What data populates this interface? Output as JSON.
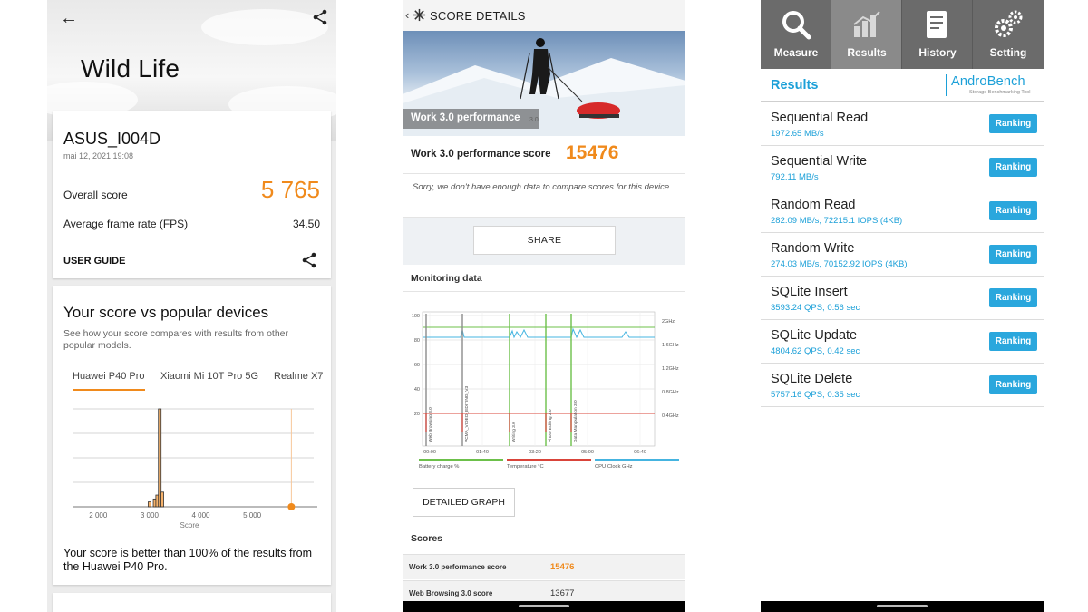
{
  "wildlife": {
    "title": "Wild Life",
    "device": "ASUS_I004D",
    "date": "mai 12, 2021 19:08",
    "overall_label": "Overall score",
    "overall_value": "5 765",
    "fps_label": "Average frame rate (FPS)",
    "fps_value": "34.50",
    "user_guide": "USER GUIDE",
    "compare_title": "Your score vs popular devices",
    "compare_sub": "See how your score compares with results from other popular models.",
    "tabs": [
      "Huawei P40 Pro",
      "Xiaomi Mi 10T Pro 5G",
      "Realme X7"
    ],
    "verdict": "Your score is better than 100% of the results from the Huawei P40 Pro.",
    "accent": "#f08a1c"
  },
  "chart_data": {
    "type": "bar",
    "title": "",
    "xlabel": "Score",
    "ylabel": "",
    "x_ticks": [
      "2 000",
      "3 000",
      "4 000",
      "5 000"
    ],
    "xlim": [
      1500,
      6200
    ],
    "ylim": [
      0,
      100
    ],
    "series": [
      {
        "x": [
          3000,
          3100,
          3150,
          3200,
          3250
        ],
        "values": [
          5,
          8,
          12,
          100,
          15
        ]
      }
    ],
    "marker_x": 5765
  },
  "pcmark": {
    "header": "SCORE DETAILS",
    "banner_label": "Work 3.0 performance",
    "score_label": "Work 3.0 performance score",
    "score_value": "15476",
    "sorry": "Sorry, we don't have enough data to compare scores for this device.",
    "share": "SHARE",
    "monitoring": "Monitoring data",
    "graph": {
      "y_ticks": [
        "100",
        "80",
        "60",
        "40",
        "20"
      ],
      "freq_ticks": [
        "2GHz",
        "1.6GHz",
        "1.2GHz",
        "0.8GHz",
        "0.4GHz"
      ],
      "x_ticks": [
        "00:00",
        "01:40",
        "03:20",
        "05:00",
        "06:40"
      ],
      "phases": [
        "Web Browsing 3.0",
        "PCMA_VIDEO_EDITING_V3",
        "Writing 3.0",
        "Photo Editing 3.0",
        "Data Manipulation 3.0"
      ],
      "legend": [
        "Battery charge %",
        "Temperature °C",
        "CPU Clock GHz"
      ],
      "colors": [
        "#6cc04a",
        "#d9443a",
        "#45b4e0"
      ]
    },
    "detailed": "DETAILED GRAPH",
    "scores_label": "Scores",
    "rows": [
      {
        "k": "Work 3.0 performance score",
        "v": "15476"
      },
      {
        "k": "Web Browsing 3.0 score",
        "v": "13677"
      }
    ]
  },
  "androbench": {
    "nav": [
      "Measure",
      "Results",
      "History",
      "Setting"
    ],
    "results_title": "Results",
    "logo": "AndroBench",
    "logo_sub": "Storage Benchmarking Tool",
    "ranking": "Ranking",
    "items": [
      {
        "n": "Sequential Read",
        "d": "1972.65 MB/s"
      },
      {
        "n": "Sequential Write",
        "d": "792.11 MB/s"
      },
      {
        "n": "Random Read",
        "d": "282.09 MB/s, 72215.1 IOPS (4KB)"
      },
      {
        "n": "Random Write",
        "d": "274.03 MB/s, 70152.92 IOPS (4KB)"
      },
      {
        "n": "SQLite Insert",
        "d": "3593.24 QPS, 0.56 sec"
      },
      {
        "n": "SQLite Update",
        "d": "4804.62 QPS, 0.42 sec"
      },
      {
        "n": "SQLite Delete",
        "d": "5757.16 QPS, 0.35 sec"
      }
    ]
  }
}
